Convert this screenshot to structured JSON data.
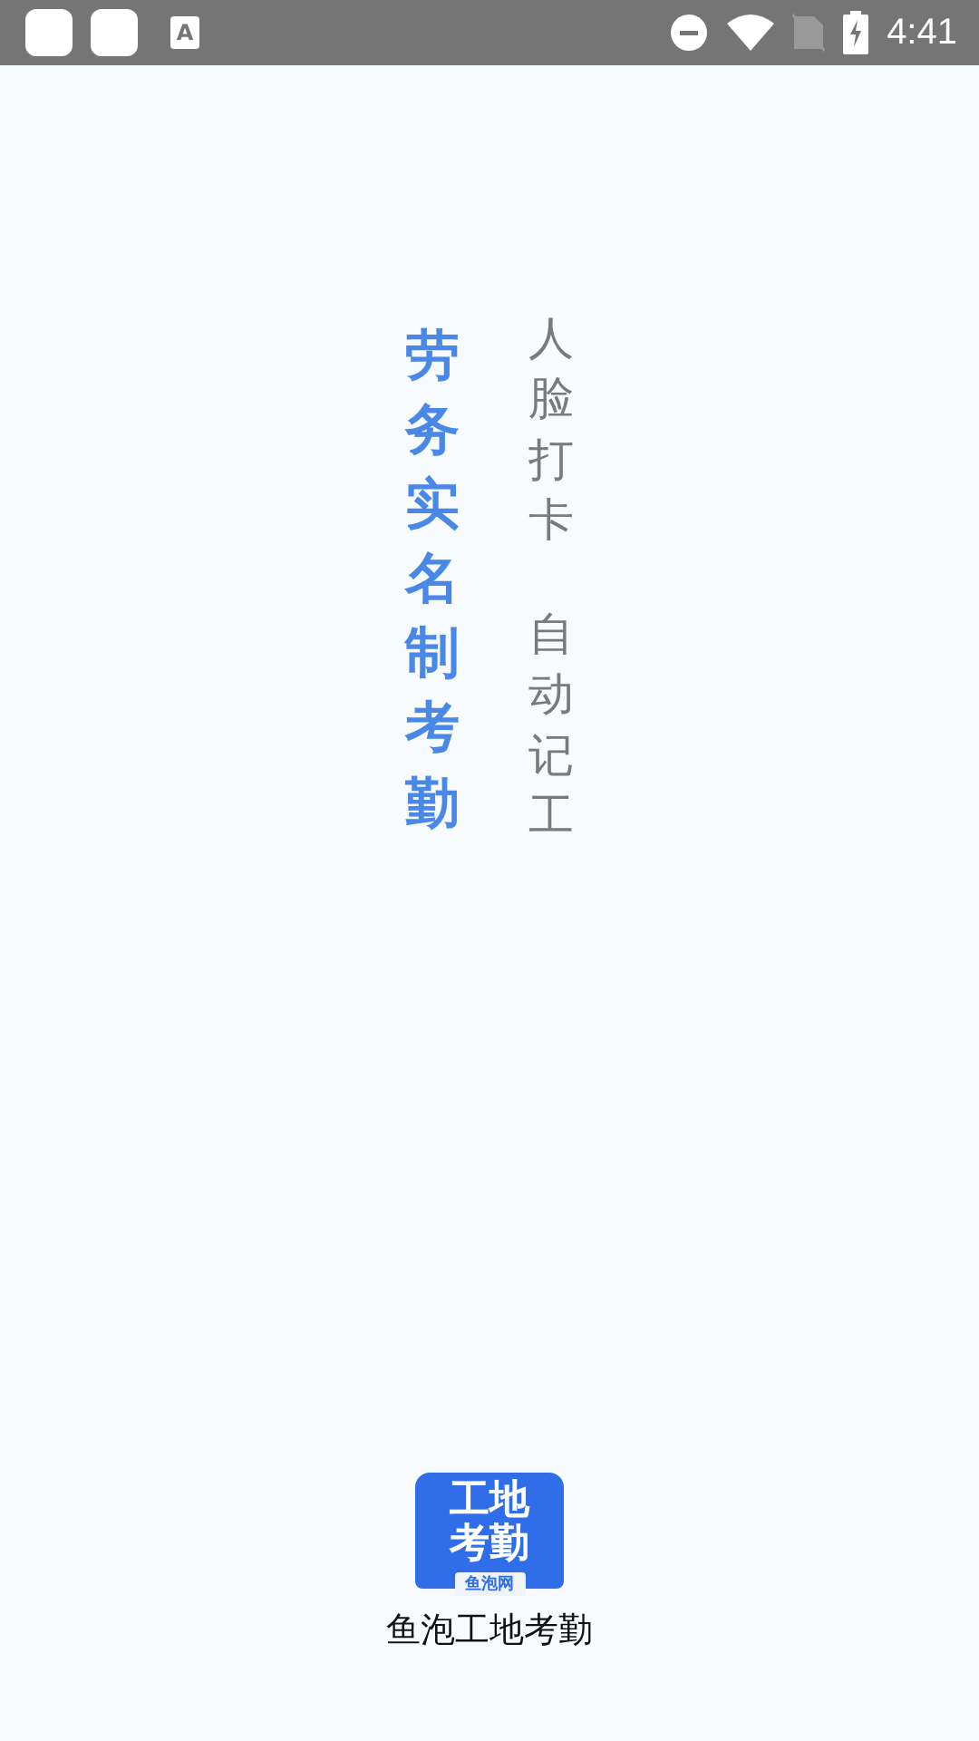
{
  "status_bar": {
    "notification_letter": "A",
    "time": "4:41"
  },
  "slogan": {
    "main": "劳务实名制考勤",
    "features": [
      "人脸打卡",
      "自动记工"
    ]
  },
  "app_icon": {
    "lines": [
      "工地",
      "考勤"
    ],
    "brand": "鱼泡网"
  },
  "app_name": "鱼泡工地考勤"
}
